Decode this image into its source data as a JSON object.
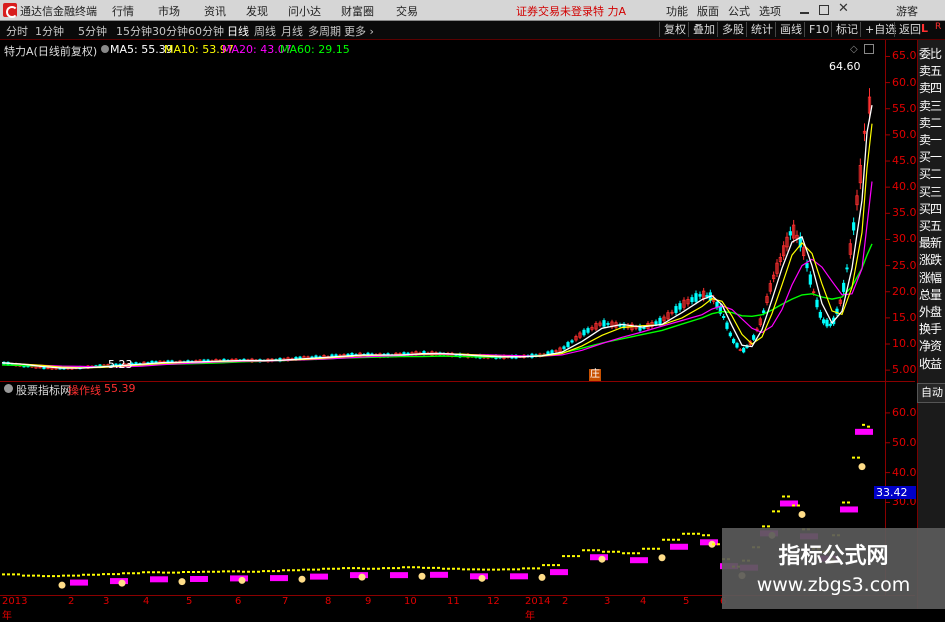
{
  "app": {
    "title": "通达信金融终端"
  },
  "menu": {
    "items": [
      "行情",
      "市场",
      "资讯",
      "发现",
      "问小达",
      "财富圈",
      "交易"
    ],
    "status": "证券交易未登录",
    "stock": "特 力A",
    "right_items": [
      "功能",
      "版面",
      "公式",
      "选项"
    ],
    "guest": "游客",
    "window_controls": [
      "minimize-icon",
      "maximize-icon",
      "close-icon"
    ]
  },
  "period_tabs": [
    "分时",
    "1分钟",
    "5分钟",
    "15分钟",
    "30分钟",
    "60分钟",
    "日线",
    "周线",
    "月线",
    "多周期",
    "更多"
  ],
  "active_period": "日线",
  "toolbar": [
    "复权",
    "叠加",
    "多股",
    "统计",
    "画线",
    "F10",
    "标记",
    "+自选",
    "返回"
  ],
  "main_chart": {
    "stock_label": "特力A(日线前复权)",
    "ma5": "MA5: 55.39",
    "ma10": "MA10: 53.97",
    "ma20": "MA20: 43.07",
    "ma60": "MA60: 29.15",
    "high_label": "64.60",
    "low_label": "5.23",
    "marker": "庄",
    "colors": {
      "ma5": "#ffffff",
      "ma10": "#ffff00",
      "ma20": "#ff00ff",
      "ma60": "#00ff00",
      "up": "#ff3030",
      "down": "#00ffff",
      "axis": "#e00000"
    }
  },
  "sub_chart": {
    "label": "股票指标网",
    "indicator_name": "操作线",
    "indicator_value": "55.39",
    "current_value": "33.42"
  },
  "right_panel": {
    "corner_top": "L",
    "corner_r": "R",
    "items": [
      "委比",
      "卖五",
      "卖四",
      "卖三",
      "卖二",
      "卖一",
      "买一",
      "买二",
      "买三",
      "买四",
      "买五",
      "最新",
      "涨跌",
      "涨幅",
      "总量",
      "外盘",
      "换手",
      "净资",
      "收益"
    ],
    "auto_button": "自动"
  },
  "watermark": {
    "line1": "指标公式网",
    "line2": "www.zbgs3.com"
  },
  "chart_data": [
    {
      "type": "line",
      "title": "特力A(日线前复权)",
      "y_axis_ticks": [
        5,
        10,
        15,
        20,
        25,
        30,
        35,
        40,
        45,
        50,
        55,
        60,
        65
      ],
      "ylim": [
        3.5,
        67
      ],
      "x_tick_labels": [
        "2013年",
        "2",
        "3",
        "4",
        "5",
        "6",
        "7",
        "8",
        "9",
        "10",
        "11",
        "12",
        "2014年",
        "2",
        "3",
        "4",
        "5",
        "6"
      ],
      "series": [
        {
          "name": "MA5",
          "value": 55.39
        },
        {
          "name": "MA10",
          "value": 53.97
        },
        {
          "name": "MA20",
          "value": 43.07
        },
        {
          "name": "MA60",
          "value": 29.15
        }
      ],
      "x": [
        0,
        20,
        40,
        60,
        80,
        100,
        120,
        140,
        160,
        180,
        200,
        220,
        240,
        260,
        280,
        300,
        320,
        340,
        360,
        380,
        400,
        420,
        440,
        460,
        480,
        500,
        520,
        540,
        560,
        580,
        600,
        620,
        640,
        660,
        680,
        700,
        710,
        720,
        730,
        740,
        750,
        760,
        770,
        780,
        790,
        800,
        810,
        820,
        830,
        840,
        850,
        860,
        865,
        870
      ],
      "close": [
        6.4,
        5.9,
        5.5,
        5.3,
        5.5,
        5.8,
        6.0,
        6.3,
        6.6,
        6.5,
        6.7,
        6.8,
        6.9,
        6.8,
        7.0,
        7.3,
        7.5,
        7.8,
        8.0,
        7.8,
        8.0,
        8.3,
        8.1,
        7.8,
        7.6,
        7.5,
        7.6,
        7.9,
        9.0,
        12.0,
        14.0,
        13.5,
        13.0,
        14.5,
        17.5,
        19.5,
        19.0,
        16.0,
        11.0,
        8.5,
        10.5,
        15.0,
        22.0,
        27.0,
        32.0,
        29.0,
        21.0,
        14.5,
        13.5,
        19.0,
        30.0,
        45.0,
        56.0,
        55.4
      ],
      "ma60": [
        6.0,
        5.9,
        5.8,
        5.7,
        5.6,
        5.7,
        5.8,
        5.9,
        6.1,
        6.2,
        6.3,
        6.4,
        6.6,
        6.7,
        6.8,
        7.0,
        7.1,
        7.3,
        7.4,
        7.5,
        7.6,
        7.6,
        7.7,
        7.6,
        7.5,
        7.5,
        7.6,
        7.8,
        8.3,
        9.2,
        10.2,
        11.0,
        11.8,
        12.6,
        13.8,
        15.0,
        15.8,
        16.2,
        16.0,
        15.4,
        15.3,
        15.6,
        16.5,
        17.6,
        18.6,
        19.4,
        19.6,
        19.0,
        18.6,
        19.0,
        21.0,
        24.5,
        27.0,
        29.15
      ]
    },
    {
      "type": "line",
      "title": "股票指标网",
      "y_axis_ticks": [
        30,
        40,
        50,
        60
      ],
      "ylim": [
        0,
        66
      ],
      "series": [
        {
          "name": "操作线",
          "value": 55.39
        }
      ],
      "current_value": 33.42
    }
  ]
}
